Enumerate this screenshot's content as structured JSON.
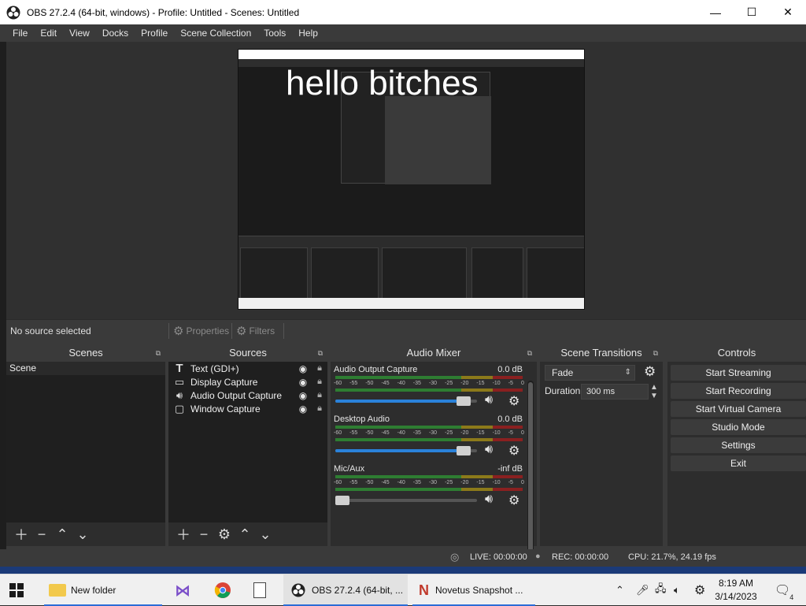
{
  "window": {
    "title": "OBS 27.2.4 (64-bit, windows) - Profile: Untitled - Scenes: Untitled",
    "minimize": "—",
    "maximize": "☐",
    "close": "✕"
  },
  "menu": [
    "File",
    "Edit",
    "View",
    "Docks",
    "Profile",
    "Scene Collection",
    "Tools",
    "Help"
  ],
  "preview": {
    "overlay_text": "hello bitches"
  },
  "selection": {
    "no_source": "No source selected",
    "properties": "Properties",
    "filters": "Filters"
  },
  "scenes": {
    "title": "Scenes",
    "items": [
      "Scene"
    ]
  },
  "sources": {
    "title": "Sources",
    "items": [
      {
        "label": "Text (GDI+)",
        "icon": "text-icon"
      },
      {
        "label": "Display Capture",
        "icon": "monitor-icon"
      },
      {
        "label": "Audio Output Capture",
        "icon": "speaker-icon"
      },
      {
        "label": "Window Capture",
        "icon": "window-icon"
      }
    ]
  },
  "mixer": {
    "title": "Audio Mixer",
    "ticks": [
      "-60",
      "-55",
      "-50",
      "-45",
      "-40",
      "-35",
      "-30",
      "-25",
      "-20",
      "-15",
      "-10",
      "-5",
      "0"
    ],
    "channels": [
      {
        "name": "Audio Output Capture",
        "db": "0.0 dB",
        "volume": 0.95
      },
      {
        "name": "Desktop Audio",
        "db": "0.0 dB",
        "volume": 0.95
      },
      {
        "name": "Mic/Aux",
        "db": "-inf dB",
        "volume": 0.0
      }
    ]
  },
  "transitions": {
    "title": "Scene Transitions",
    "selected": "Fade",
    "duration_label": "Duration",
    "duration_value": "300 ms"
  },
  "controls": {
    "title": "Controls",
    "buttons": [
      "Start Streaming",
      "Start Recording",
      "Start Virtual Camera",
      "Studio Mode",
      "Settings",
      "Exit"
    ]
  },
  "status": {
    "live": "LIVE: 00:00:00",
    "rec": "REC: 00:00:00",
    "cpu": "CPU: 21.7%, 24.19 fps"
  },
  "taskbar": {
    "folder": "New folder",
    "obs": "OBS 27.2.4 (64-bit, ...",
    "novetus": "Novetus Snapshot ...",
    "time": "8:19 AM",
    "date": "3/14/2023",
    "notifications": "4"
  },
  "colors": {
    "accent": "#2a82da",
    "dock_bg": "#2d2d2d",
    "panel_bg": "#1f1f1f"
  }
}
